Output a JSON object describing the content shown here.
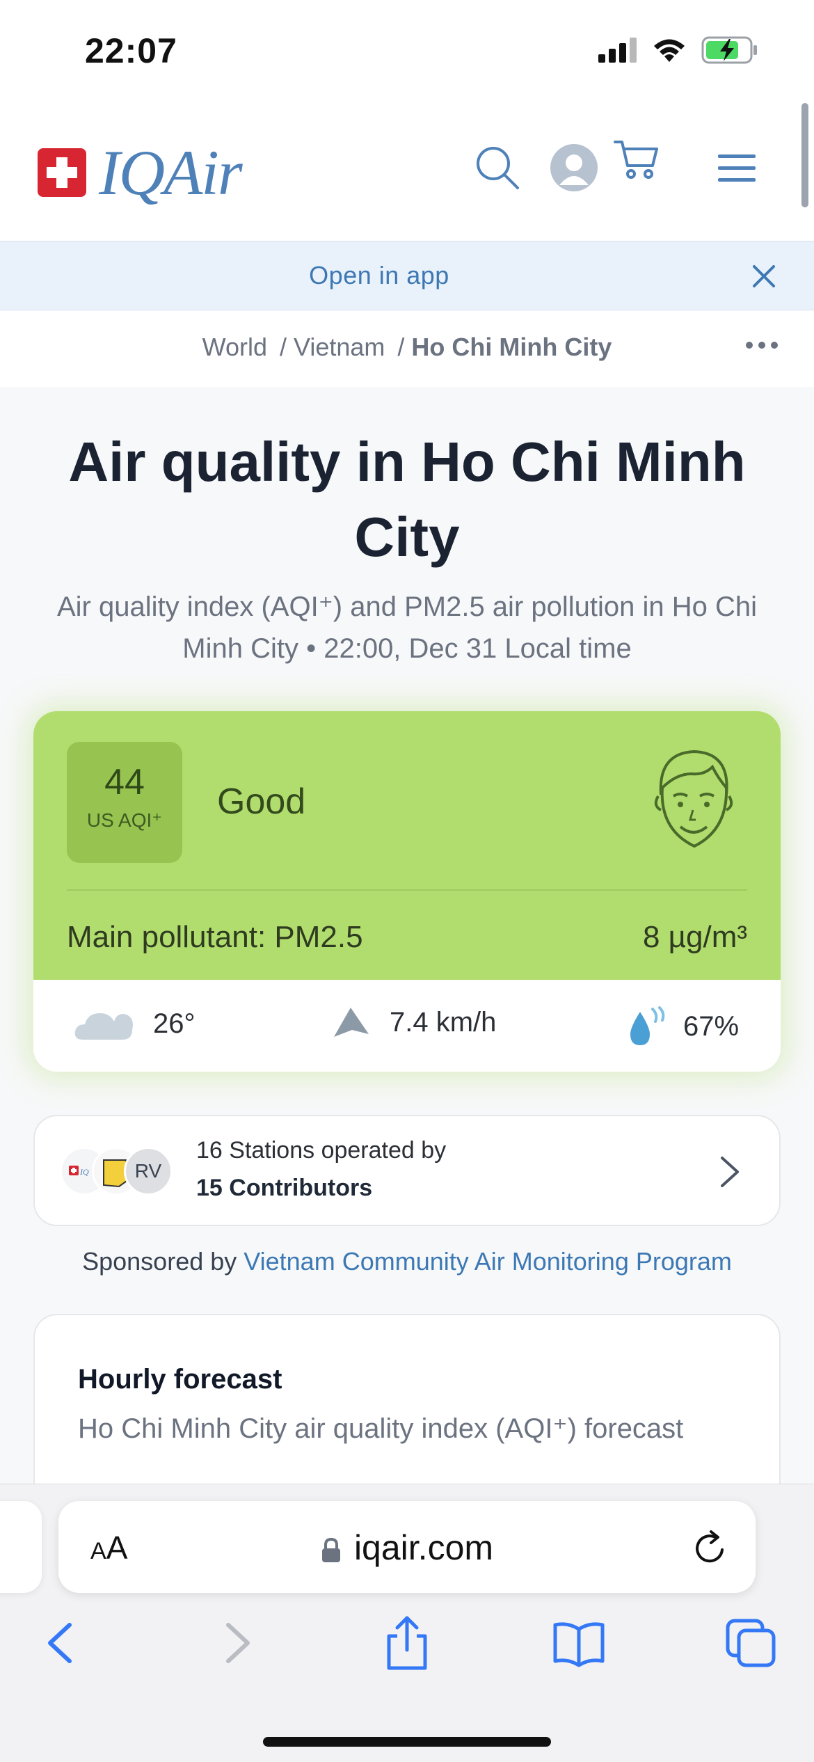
{
  "status_bar": {
    "time": "22:07"
  },
  "header": {
    "logo_text": "IQAir",
    "icons": [
      "search-icon",
      "user-avatar-icon",
      "cart-icon",
      "hamburger-menu-icon"
    ]
  },
  "app_banner": {
    "link_label": "Open in app"
  },
  "breadcrumb": {
    "items": [
      "World",
      "Vietnam",
      "Ho Chi Minh City"
    ],
    "separator": "/"
  },
  "main": {
    "title": "Air quality in Ho Chi Minh City",
    "subtitle": "Air quality index (AQI⁺) and PM2.5 air pollution in Ho Chi Minh City • 22:00, Dec 31 Local time"
  },
  "aqi": {
    "value": "44",
    "unit": "US AQI⁺",
    "level": "Good",
    "pollutant_label": "Main pollutant: PM2.5",
    "pollutant_value": "8  µg/m³",
    "colors": {
      "card": "#b1dd6e",
      "badge": "#97c450"
    }
  },
  "weather": {
    "temperature": "26°",
    "wind": "7.4 km/h",
    "humidity": "67%"
  },
  "stations": {
    "line1": "16 Stations operated by",
    "line2": "15 Contributors",
    "avatar_initials": "RV"
  },
  "sponsored": {
    "prefix": "Sponsored by",
    "link": "Vietnam Community Air Monitoring Program"
  },
  "forecast": {
    "title": "Hourly forecast",
    "subtitle": "Ho Chi Minh City air quality index (AQI⁺) forecast"
  },
  "browser": {
    "aa_label_small": "A",
    "aa_label_large": "A",
    "url": "iqair.com"
  }
}
